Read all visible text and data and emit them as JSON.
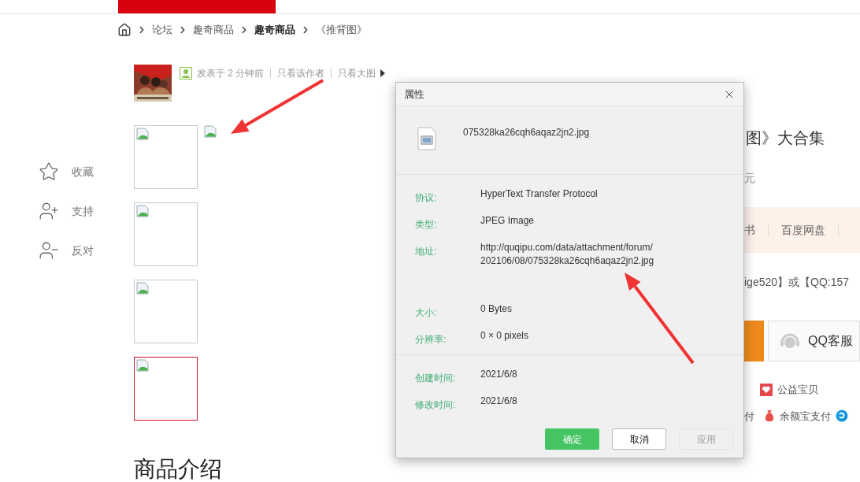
{
  "breadcrumb": [
    {
      "label": "论坛",
      "bold": false
    },
    {
      "label": "趣奇商品",
      "bold": false
    },
    {
      "label": "趣奇商品",
      "bold": true
    },
    {
      "label": "《推背图》",
      "bold": false
    }
  ],
  "post": {
    "meta": "发表于 2 分钟前",
    "links": [
      "只看该作者",
      "只看大图"
    ]
  },
  "thumbnails": [
    {
      "selected": false
    },
    {
      "selected": false
    },
    {
      "selected": false
    },
    {
      "selected": true
    }
  ],
  "actions": [
    {
      "kind": "favorite",
      "label": "收藏"
    },
    {
      "kind": "support",
      "label": "支持"
    },
    {
      "kind": "oppose",
      "label": "反对"
    }
  ],
  "section_heading": "商品介绍",
  "product": {
    "title": "图》大合集",
    "price": "元",
    "tabs": [
      "书",
      "百度网盘"
    ],
    "contact": "ige520】或【QQ:157",
    "service_button": "QQ客服",
    "badges": [
      {
        "kind": "charity",
        "label": "公益宝贝"
      }
    ],
    "payments": [
      {
        "kind": "plain",
        "label": "付"
      },
      {
        "kind": "yuebao",
        "label": "余额宝支付"
      },
      {
        "kind": "antpay"
      }
    ]
  },
  "dialog": {
    "title": "属性",
    "filename": "075328ka26cqh6aqaz2jn2.jpg",
    "sections": [
      {
        "groups": [
          [
            {
              "label": "协议:",
              "value": "HyperText Transfer Protocol"
            },
            {
              "label": "类型:",
              "value": "JPEG Image"
            },
            {
              "label": "地址:",
              "value": "http://quqipu.com/data/attachment/forum/\n202106/08/075328ka26cqh6aqaz2jn2.jpg"
            }
          ],
          [
            {
              "label": "大小:",
              "value": "0 Bytes"
            },
            {
              "label": "分辨率:",
              "value": "0 × 0 pixels"
            }
          ]
        ]
      },
      {
        "groups": [
          [
            {
              "label": "创建时间:",
              "value": "2021/6/8"
            },
            {
              "label": "修改时间:",
              "value": "2021/6/8"
            }
          ]
        ]
      }
    ],
    "buttons": [
      {
        "label": "确定",
        "kind": "primary",
        "disabled": false
      },
      {
        "label": "取消",
        "kind": "default",
        "disabled": false
      },
      {
        "label": "应用",
        "kind": "default",
        "disabled": true
      }
    ]
  }
}
